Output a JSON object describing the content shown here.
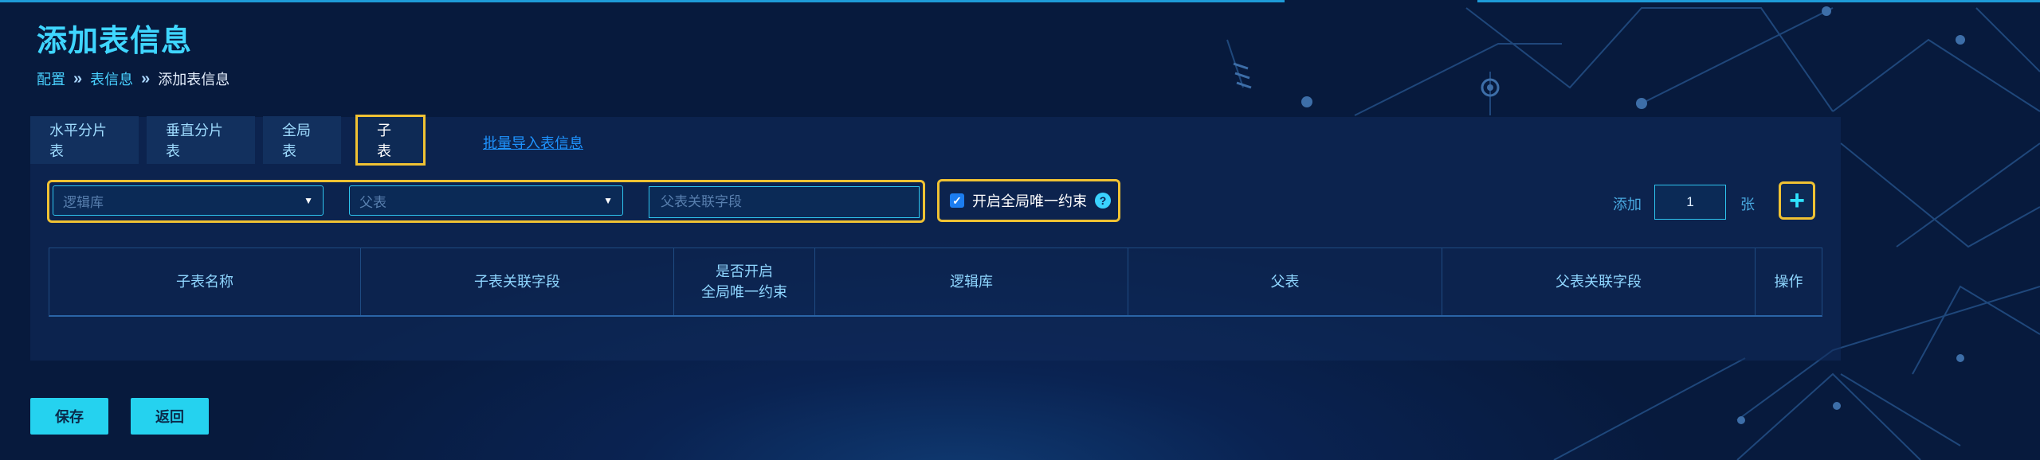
{
  "page": {
    "title": "添加表信息"
  },
  "breadcrumb": {
    "items": [
      "配置",
      "表信息",
      "添加表信息"
    ],
    "separator": "»"
  },
  "tabs": [
    {
      "label": "水平分片表",
      "active": false
    },
    {
      "label": "垂直分片表",
      "active": false
    },
    {
      "label": "全局表",
      "active": false
    },
    {
      "label": "子表",
      "active": true
    }
  ],
  "batch_import": {
    "label": "批量导入表信息"
  },
  "form": {
    "logic_db": {
      "placeholder": "逻辑库"
    },
    "parent_table": {
      "placeholder": "父表"
    },
    "parent_field": {
      "placeholder": "父表关联字段",
      "value": ""
    },
    "global_unique": {
      "label": "开启全局唯一约束",
      "checked": true,
      "help": "?"
    },
    "add": {
      "label": "添加",
      "count": "1",
      "unit": "张",
      "plus": "+"
    }
  },
  "table": {
    "headers": [
      "子表名称",
      "子表关联字段",
      "是否开启",
      "全局唯一约束",
      "逻辑库",
      "父表",
      "父表关联字段",
      "操作"
    ],
    "rows": []
  },
  "actions": {
    "save": "保存",
    "back": "返回"
  },
  "colors": {
    "accent": "#25d2ef",
    "highlight": "#f0c233",
    "link": "#1e93ff",
    "background": "#071a3d"
  }
}
